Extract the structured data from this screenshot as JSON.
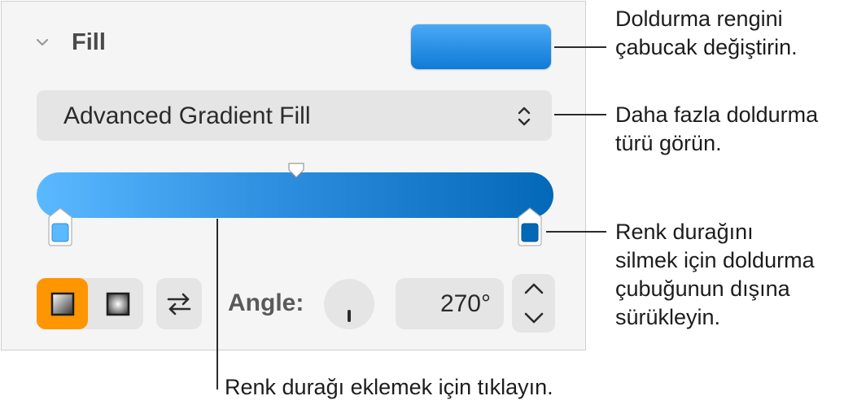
{
  "fill_panel": {
    "section_title": "Fill",
    "collapse_icon": "chevron-down-icon",
    "color_well_color": "#1a86e0",
    "fill_type": "Advanced Gradient Fill",
    "fill_type_icon": "up-down-chevron-icon",
    "gradient": {
      "start_color": "#5ab9ff",
      "end_color": "#0468b8",
      "stops": [
        {
          "position": 0.0,
          "color": "#5ab9ff"
        },
        {
          "position": 1.0,
          "color": "#0468b8"
        }
      ],
      "midpoint": 0.5
    },
    "gradient_style": {
      "active": "linear",
      "options": [
        "linear",
        "radial"
      ]
    },
    "swap_icon": "swap-arrows-icon",
    "angle_label": "Angle:",
    "angle_value": "270°",
    "accent_color": "#ff9500"
  },
  "callouts": {
    "color_well": [
      "Doldurma rengini",
      "çabucak değiştirin."
    ],
    "fill_type": [
      "Daha fazla doldurma",
      "türü görün."
    ],
    "color_stop": [
      "Renk durağını",
      "silmek için doldurma",
      "çubuğunun dışına",
      "sürükleyin."
    ],
    "add_stop": "Renk durağı eklemek için tıklayın."
  }
}
